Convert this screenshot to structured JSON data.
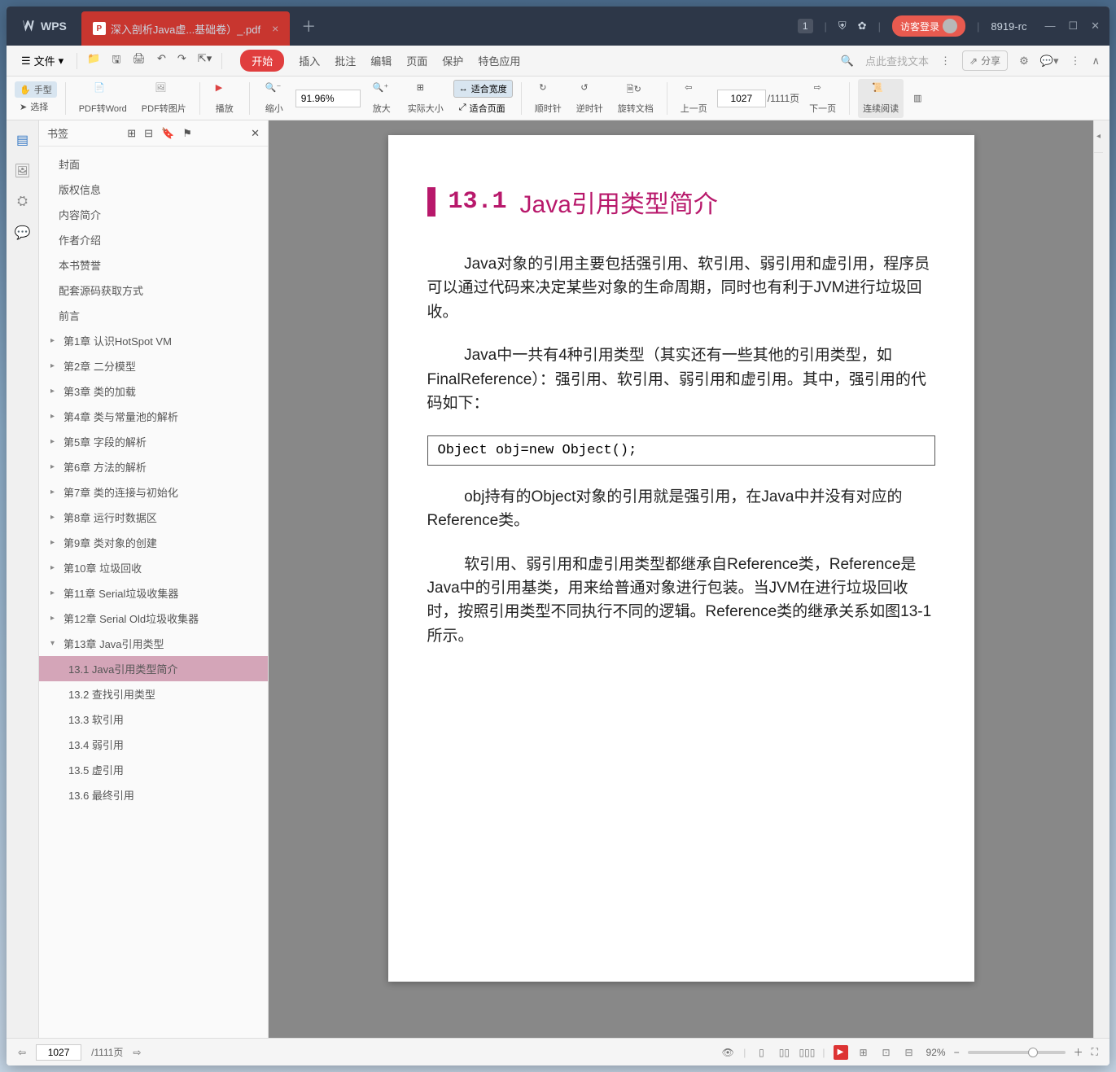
{
  "titlebar": {
    "app_name": "WPS",
    "tab_title": "深入剖析Java虚...基础卷）_.pdf",
    "tab_count": "1",
    "login_label": "访客登录",
    "version": "8919-rc"
  },
  "menubar": {
    "file_label": "文件",
    "tabs": [
      "开始",
      "插入",
      "批注",
      "编辑",
      "页面",
      "保护",
      "特色应用"
    ],
    "search_placeholder": "点此查找文本",
    "share_label": "分享"
  },
  "toolbar": {
    "hand": "手型",
    "select": "选择",
    "pdf_word": "PDF转Word",
    "pdf_img": "PDF转图片",
    "play": "播放",
    "shrink": "缩小",
    "zoom_value": "91.96%",
    "enlarge": "放大",
    "actual": "实际大小",
    "fit_width": "适合宽度",
    "fit_page": "适合页面",
    "clockwise": "顺时针",
    "counter": "逆时针",
    "rotate": "旋转文档",
    "prev": "上一页",
    "next": "下一页",
    "page_value": "1027",
    "page_total": "/1111页",
    "cont_read": "连续阅读"
  },
  "bookmarks": {
    "title": "书签",
    "items": [
      {
        "label": "封面",
        "type": "leaf"
      },
      {
        "label": "版权信息",
        "type": "leaf"
      },
      {
        "label": "内容简介",
        "type": "leaf"
      },
      {
        "label": "作者介绍",
        "type": "leaf"
      },
      {
        "label": "本书赞誉",
        "type": "leaf"
      },
      {
        "label": "配套源码获取方式",
        "type": "leaf"
      },
      {
        "label": "前言",
        "type": "leaf"
      },
      {
        "label": "第1章 认识HotSpot VM",
        "type": "ch"
      },
      {
        "label": "第2章 二分模型",
        "type": "ch"
      },
      {
        "label": "第3章 类的加载",
        "type": "ch"
      },
      {
        "label": "第4章 类与常量池的解析",
        "type": "ch"
      },
      {
        "label": "第5章 字段的解析",
        "type": "ch"
      },
      {
        "label": "第6章 方法的解析",
        "type": "ch"
      },
      {
        "label": "第7章 类的连接与初始化",
        "type": "ch"
      },
      {
        "label": "第8章 运行时数据区",
        "type": "ch"
      },
      {
        "label": "第9章 类对象的创建",
        "type": "ch"
      },
      {
        "label": "第10章 垃圾回收",
        "type": "ch"
      },
      {
        "label": "第11章 Serial垃圾收集器",
        "type": "ch"
      },
      {
        "label": "第12章 Serial Old垃圾收集器",
        "type": "ch"
      },
      {
        "label": "第13章 Java引用类型",
        "type": "ch-open"
      },
      {
        "label": "13.1 Java引用类型简介",
        "type": "sub-selected"
      },
      {
        "label": "13.2 查找引用类型",
        "type": "sub"
      },
      {
        "label": "13.3 软引用",
        "type": "sub"
      },
      {
        "label": "13.4 弱引用",
        "type": "sub"
      },
      {
        "label": "13.5 虚引用",
        "type": "sub"
      },
      {
        "label": "13.6 最终引用",
        "type": "sub"
      }
    ]
  },
  "page": {
    "heading_num": "13.1",
    "heading_text": "Java引用类型简介",
    "p1": "Java对象的引用主要包括强引用、软引用、弱引用和虚引用，程序员可以通过代码来决定某些对象的生命周期，同时也有利于JVM进行垃圾回收。",
    "p2": "Java中一共有4种引用类型（其实还有一些其他的引用类型，如FinalReference）：强引用、软引用、弱引用和虚引用。其中，强引用的代码如下：",
    "code": "Object obj=new Object();",
    "p3": "obj持有的Object对象的引用就是强引用，在Java中并没有对应的Reference类。",
    "p4": "软引用、弱引用和虚引用类型都继承自Reference类，Reference是Java中的引用基类，用来给普通对象进行包装。当JVM在进行垃圾回收时，按照引用类型不同执行不同的逻辑。Reference类的继承关系如图13-1所示。"
  },
  "statusbar": {
    "page_value": "1027",
    "page_total": "/1111页",
    "zoom": "92%"
  }
}
